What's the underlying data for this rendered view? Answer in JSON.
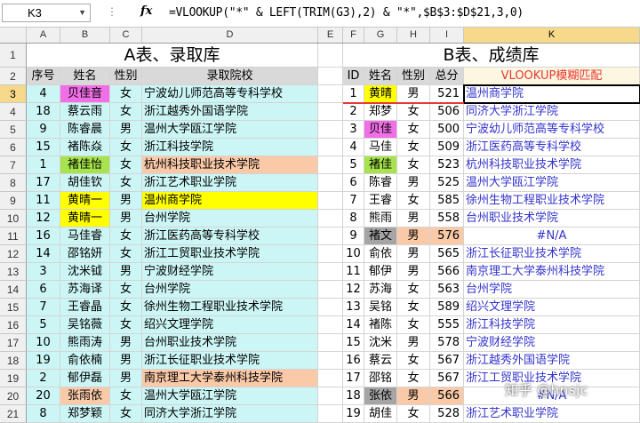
{
  "formula_bar": {
    "cell_ref": "K3",
    "fx": "fx",
    "formula": "=VLOOKUP(\"*\" & LEFT(TRIM(G3),2) & \"*\",$B$3:$D$21,3,0)"
  },
  "columns": [
    "A",
    "B",
    "C",
    "D",
    "E",
    "F",
    "G",
    "H",
    "I",
    "K"
  ],
  "row_numbers": [
    "1",
    "2",
    "3",
    "4",
    "5",
    "6",
    "7",
    "8",
    "9",
    "10",
    "11",
    "12",
    "13",
    "14",
    "15",
    "16",
    "17",
    "18",
    "19",
    "20",
    "21"
  ],
  "titles": {
    "a": "A表、录取库",
    "b": "B表、成绩库"
  },
  "table_a": {
    "headers": [
      "序号",
      "姓名",
      "性别",
      "录取院校"
    ],
    "rows": [
      [
        "4",
        "贝佳音",
        "女",
        "宁波幼儿师范高等专科学校"
      ],
      [
        "18",
        "蔡云雨",
        "女",
        "浙江越秀外国语学院"
      ],
      [
        "9",
        "陈睿晨",
        "男",
        "温州大学瓯江学院"
      ],
      [
        "15",
        "褚陈焱",
        "女",
        "浙江科技学院"
      ],
      [
        "1",
        "褚佳怡",
        "女",
        "杭州科技职业技术学院"
      ],
      [
        "17",
        "胡佳钦",
        "女",
        "浙江艺术职业学院"
      ],
      [
        "11",
        "黄晴一",
        "男",
        "温州商学院"
      ],
      [
        "12",
        "黄晴一",
        "男",
        "台州学院"
      ],
      [
        "16",
        "马佳睿",
        "女",
        "浙江医药高等专科学校"
      ],
      [
        "14",
        "邵铭妍",
        "女",
        "浙江工贸职业技术学院"
      ],
      [
        "3",
        "沈米钺",
        "男",
        "宁波财经学院"
      ],
      [
        "6",
        "苏海译",
        "女",
        "台州学院"
      ],
      [
        "7",
        "王睿晶",
        "女",
        "徐州生物工程职业技术学院"
      ],
      [
        "5",
        "吴铭薇",
        "女",
        "绍兴文理学院"
      ],
      [
        "10",
        "熊雨涛",
        "男",
        "台州职业技术学院"
      ],
      [
        "19",
        "俞依楠",
        "男",
        "浙江长征职业技术学院"
      ],
      [
        "2",
        "郁伊磊",
        "男",
        "南京理工大学泰州科技学院"
      ],
      [
        "20",
        "张雨依",
        "女",
        "温州大学瓯江学院"
      ],
      [
        "8",
        "郑梦颖",
        "女",
        "同济大学浙江学院"
      ]
    ]
  },
  "table_b": {
    "headers": [
      "ID",
      "姓名",
      "性别",
      "总分",
      "VLOOKUP模糊匹配"
    ],
    "rows": [
      [
        "1",
        "黄晴",
        "男",
        "521",
        "温州商学院"
      ],
      [
        "2",
        "郑梦",
        "女",
        "506",
        "同济大学浙江学院"
      ],
      [
        "3",
        "贝佳",
        "女",
        "500",
        "宁波幼儿师范高等专科学校"
      ],
      [
        "4",
        "马佳",
        "女",
        "509",
        "浙江医药高等专科学校"
      ],
      [
        "5",
        "褚佳",
        "女",
        "523",
        "杭州科技职业技术学院"
      ],
      [
        "6",
        "陈睿",
        "男",
        "525",
        "温州大学瓯江学院"
      ],
      [
        "7",
        "王睿",
        "女",
        "585",
        "徐州生物工程职业技术学院"
      ],
      [
        "8",
        "熊雨",
        "男",
        "558",
        "台州职业技术学院"
      ],
      [
        "9",
        "褚文",
        "男",
        "576",
        "#N/A"
      ],
      [
        "10",
        "俞依",
        "男",
        "565",
        "浙江长征职业技术学院"
      ],
      [
        "11",
        "郁伊",
        "男",
        "566",
        "南京理工大学泰州科技学院"
      ],
      [
        "12",
        "苏海",
        "女",
        "563",
        "台州学院"
      ],
      [
        "13",
        "吴铭",
        "女",
        "589",
        "绍兴文理学院"
      ],
      [
        "14",
        "褚陈",
        "女",
        "555",
        "浙江科技学院"
      ],
      [
        "15",
        "沈米",
        "男",
        "578",
        "宁波财经学院"
      ],
      [
        "16",
        "蔡云",
        "女",
        "567",
        "浙江越秀外国语学院"
      ],
      [
        "17",
        "邵铭",
        "女",
        "567",
        "浙江工贸职业技术学院"
      ],
      [
        "18",
        "张依",
        "男",
        "566",
        "#N/A"
      ],
      [
        "19",
        "胡佳",
        "女",
        "528",
        "浙江艺术职业学院"
      ]
    ]
  },
  "watermark": "知乎 @hnsjc",
  "colors": {
    "cyan": "#ccf5f5",
    "magenta": "#f06ee6",
    "yellow": "#ffff00",
    "green": "#a6e34c",
    "peach": "#f9c9a8",
    "gray": "#a5a5a5",
    "header_gray": "#d9d9d9",
    "orange_fill": "#f9c9a8",
    "accent_red": "#e53935",
    "link_blue": "#3333cc"
  }
}
